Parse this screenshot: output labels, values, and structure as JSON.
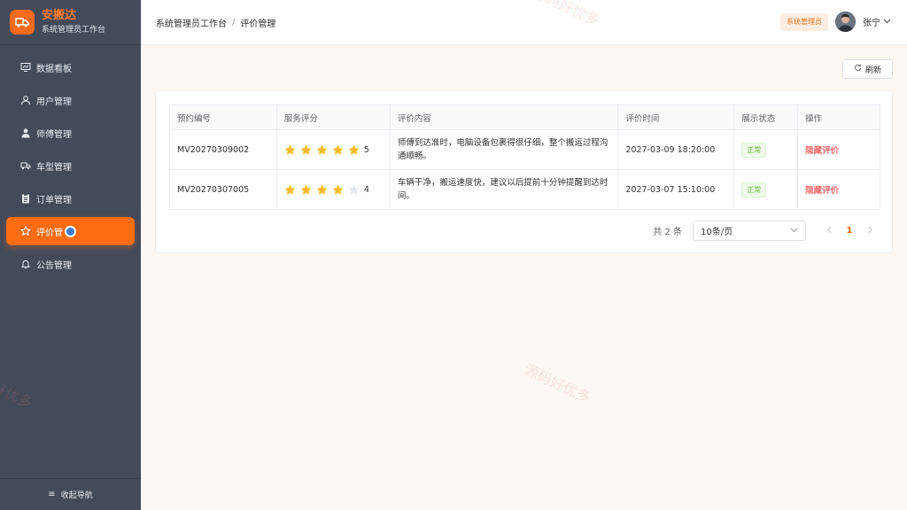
{
  "brand": {
    "name": "安搬达",
    "subtitle": "系统管理员工作台"
  },
  "menu": [
    {
      "label": "数据看板",
      "icon": "dashboard-icon"
    },
    {
      "label": "用户管理",
      "icon": "user-icon"
    },
    {
      "label": "师傅管理",
      "icon": "worker-icon"
    },
    {
      "label": "车型管理",
      "icon": "truck-icon"
    },
    {
      "label": "订单管理",
      "icon": "clipboard-icon"
    },
    {
      "label": "评价管",
      "icon": "star-icon",
      "active": true
    },
    {
      "label": "公告管理",
      "icon": "bell-icon"
    }
  ],
  "sidebar_footer": {
    "collapse_label": "收起导航"
  },
  "header": {
    "breadcrumb": [
      "系统管理员工作台",
      "评价管理"
    ],
    "breadcrumb_separator": "/",
    "role_badge": "系统管理员",
    "user_name": "张宁"
  },
  "toolbar": {
    "refresh_label": "刷新"
  },
  "table": {
    "columns": [
      "预约编号",
      "服务评分",
      "评价内容",
      "评价时间",
      "展示状态",
      "操作"
    ],
    "rows": [
      {
        "booking_id": "MV20270309002",
        "rating": 5,
        "content": "师傅到达准时，电脑设备包裹得很仔细，整个搬运过程沟通顺畅。",
        "time": "2027-03-09 18:20:00",
        "status": "正常",
        "action": "隐藏评价"
      },
      {
        "booking_id": "MV20270307005",
        "rating": 4,
        "content": "车辆干净，搬运速度快，建议以后提前十分钟提醒到达时间。",
        "time": "2027-03-07 15:10:00",
        "status": "正常",
        "action": "隐藏评价"
      }
    ]
  },
  "pagination": {
    "total_label": "共 2 条",
    "page_size": "10条/页",
    "current_page": "1"
  },
  "watermark_text": "源码好优多",
  "colors": {
    "accent": "#ff6d12",
    "sidebar_bg": "#434a5a",
    "star": "#f7ba2a",
    "star_empty": "#e4e7ed",
    "danger": "#f56c6c",
    "success": "#67c23a"
  }
}
